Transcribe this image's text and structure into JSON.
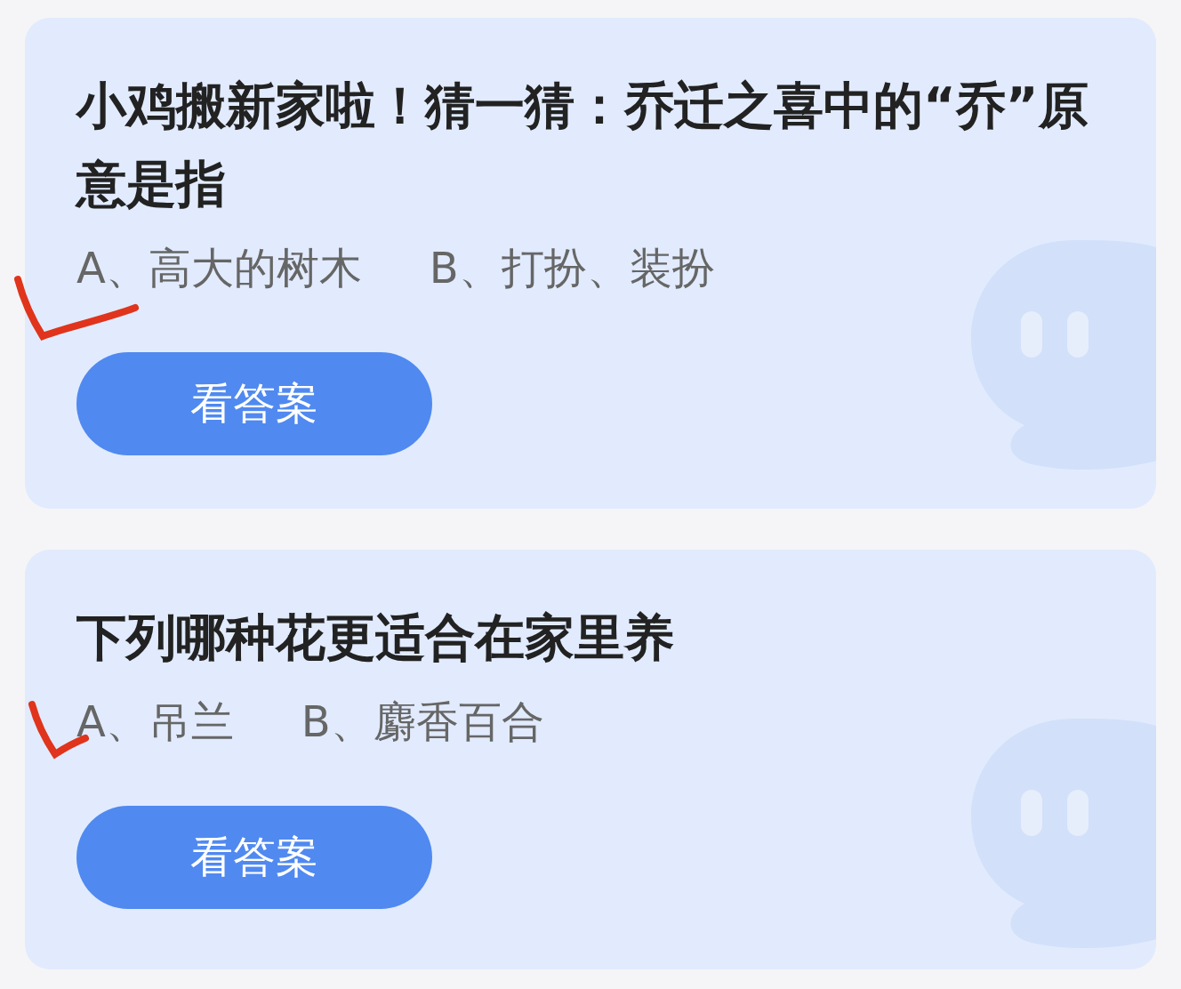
{
  "cards": [
    {
      "question": "小鸡搬新家啦！猜一猜：乔迁之喜中的“乔”原意是指",
      "options": [
        {
          "text": "A、高大的树木",
          "checked": true
        },
        {
          "text": "B、打扮、装扮",
          "checked": false
        }
      ],
      "button": "看答案"
    },
    {
      "question": "下列哪种花更适合在家里养",
      "options": [
        {
          "text": "A、吊兰",
          "checked": true
        },
        {
          "text": "B、麝香百合",
          "checked": false
        }
      ],
      "button": "看答案"
    }
  ]
}
